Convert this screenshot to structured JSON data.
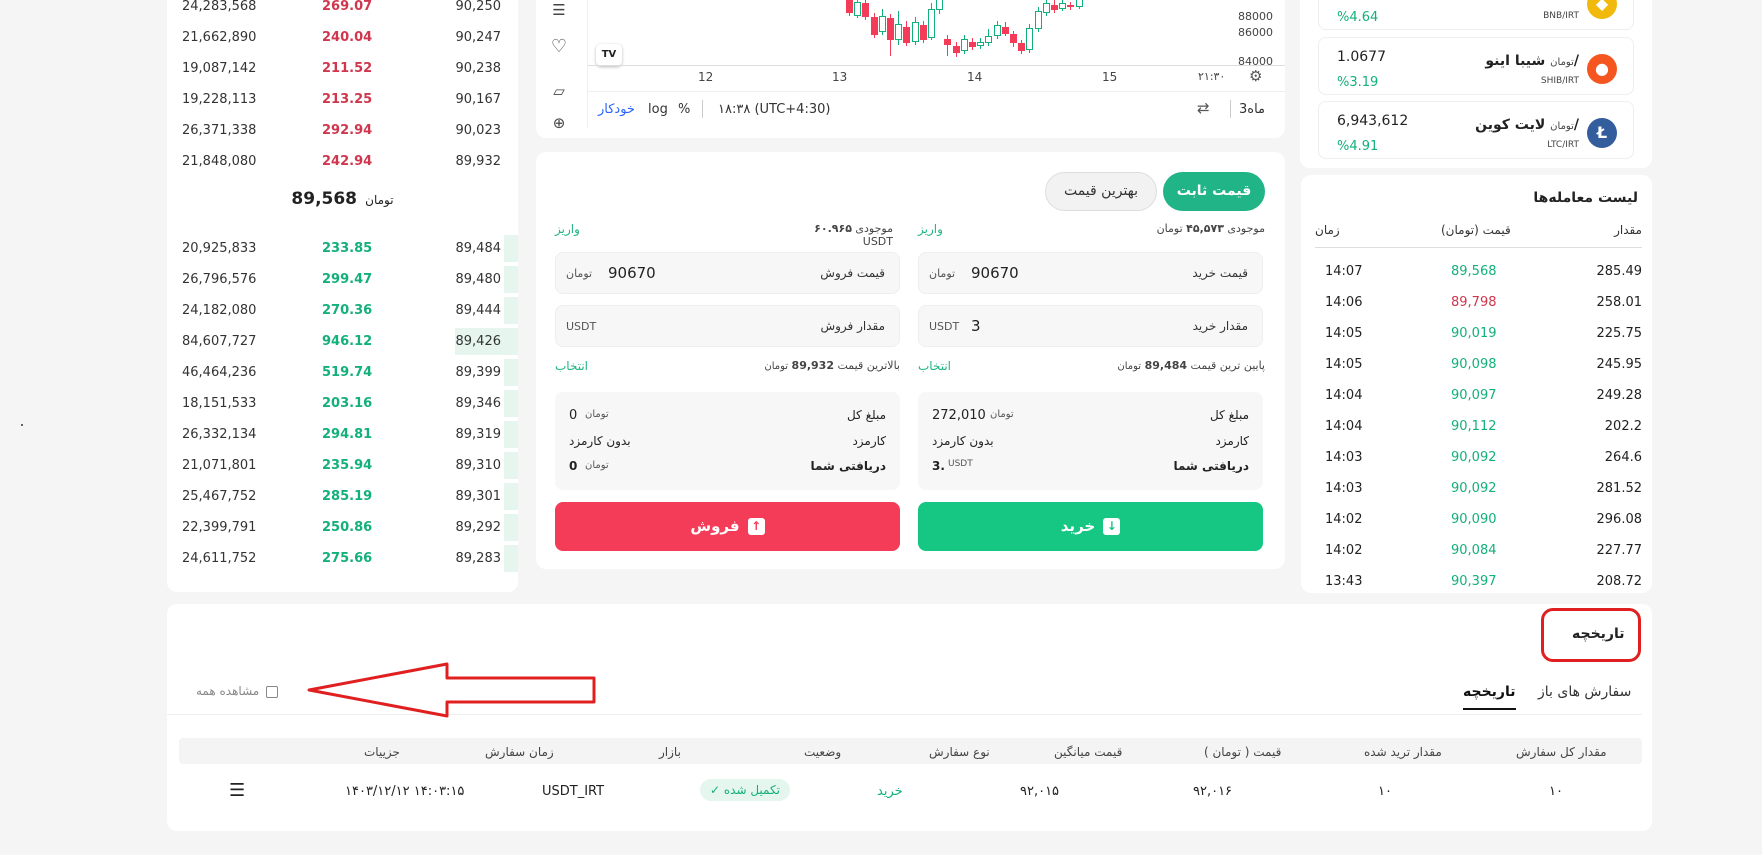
{
  "orderbook": {
    "asks": [
      {
        "total": "24,283,568",
        "amount": "269.07",
        "price": "90,250"
      },
      {
        "total": "21,662,890",
        "amount": "240.04",
        "price": "90,247"
      },
      {
        "total": "19,087,142",
        "amount": "211.52",
        "price": "90,238"
      },
      {
        "total": "19,228,113",
        "amount": "213.25",
        "price": "90,167"
      },
      {
        "total": "26,371,338",
        "amount": "292.94",
        "price": "90,023"
      },
      {
        "total": "21,848,080",
        "amount": "242.94",
        "price": "89,932"
      }
    ],
    "last_price": "89,568",
    "last_unit": "تومان",
    "bids": [
      {
        "total": "20,925,833",
        "amount": "233.85",
        "price": "89,484",
        "depth": 0.04
      },
      {
        "total": "26,796,576",
        "amount": "299.47",
        "price": "89,480",
        "depth": 0.04
      },
      {
        "total": "24,182,080",
        "amount": "270.36",
        "price": "89,444",
        "depth": 0.04
      },
      {
        "total": "84,607,727",
        "amount": "946.12",
        "price": "89,426",
        "depth": 0.18
      },
      {
        "total": "46,464,236",
        "amount": "519.74",
        "price": "89,399",
        "depth": 0.04
      },
      {
        "total": "18,151,533",
        "amount": "203.16",
        "price": "89,346",
        "depth": 0.04
      },
      {
        "total": "26,332,134",
        "amount": "294.81",
        "price": "89,319",
        "depth": 0.04
      },
      {
        "total": "21,071,801",
        "amount": "235.94",
        "price": "89,310",
        "depth": 0.04
      },
      {
        "total": "25,467,752",
        "amount": "285.19",
        "price": "89,301",
        "depth": 0.04
      },
      {
        "total": "22,399,791",
        "amount": "250.86",
        "price": "89,292",
        "depth": 0.04
      },
      {
        "total": "24,611,752",
        "amount": "275.66",
        "price": "89,283",
        "depth": 0.04
      }
    ]
  },
  "chart": {
    "price_ticks": [
      "88000",
      "86000",
      "84000"
    ],
    "time_ticks": [
      "12",
      "13",
      "14",
      "15",
      "۲۱:۳۰"
    ],
    "toolbar": {
      "auto": "خودکار",
      "log": "log",
      "percent": "%",
      "time": "۱۸:۳۸ (UTC+4:30)",
      "range": "3ماه"
    },
    "logo": "TV",
    "candles": [
      {
        "o": 88600,
        "c": 87600,
        "h": 88900,
        "l": 87400
      },
      {
        "o": 87400,
        "c": 88400,
        "h": 88800,
        "l": 87200
      },
      {
        "o": 88300,
        "c": 87300,
        "h": 88700,
        "l": 87100
      },
      {
        "o": 87300,
        "c": 86000,
        "h": 87600,
        "l": 85800
      },
      {
        "o": 86200,
        "c": 87400,
        "h": 87900,
        "l": 86000
      },
      {
        "o": 87200,
        "c": 85600,
        "h": 87500,
        "l": 84500
      },
      {
        "o": 85600,
        "c": 86800,
        "h": 87700,
        "l": 85300
      },
      {
        "o": 86600,
        "c": 85400,
        "h": 87000,
        "l": 85200
      },
      {
        "o": 85500,
        "c": 86900,
        "h": 87300,
        "l": 85300
      },
      {
        "o": 86700,
        "c": 85600,
        "h": 87000,
        "l": 85400
      },
      {
        "o": 85800,
        "c": 87900,
        "h": 88300,
        "l": 85600
      },
      {
        "o": 87800,
        "c": 88600,
        "h": 88900,
        "l": 87500
      },
      {
        "o": 85700,
        "c": 85300,
        "h": 86000,
        "l": 84500
      },
      {
        "o": 85200,
        "c": 84700,
        "h": 85500,
        "l": 84400
      },
      {
        "o": 84800,
        "c": 85700,
        "h": 86000,
        "l": 84600
      },
      {
        "o": 85500,
        "c": 85100,
        "h": 85800,
        "l": 84900
      },
      {
        "o": 85200,
        "c": 85500,
        "h": 85800,
        "l": 85000
      },
      {
        "o": 85400,
        "c": 85900,
        "h": 86400,
        "l": 85200
      },
      {
        "o": 85900,
        "c": 86700,
        "h": 87000,
        "l": 85700
      },
      {
        "o": 86600,
        "c": 86100,
        "h": 86900,
        "l": 85900
      },
      {
        "o": 86100,
        "c": 85400,
        "h": 86300,
        "l": 85100
      },
      {
        "o": 85400,
        "c": 84800,
        "h": 85600,
        "l": 84600
      },
      {
        "o": 84900,
        "c": 86500,
        "h": 86800,
        "l": 84700
      },
      {
        "o": 86400,
        "c": 87700,
        "h": 88000,
        "l": 86200
      },
      {
        "o": 87600,
        "c": 88300,
        "h": 88700,
        "l": 87400
      },
      {
        "o": 88200,
        "c": 87800,
        "h": 88500,
        "l": 87600
      },
      {
        "o": 87900,
        "c": 88300,
        "h": 88500,
        "l": 87700
      },
      {
        "o": 88200,
        "c": 88000,
        "h": 88400,
        "l": 87800
      },
      {
        "o": 88000,
        "c": 89000,
        "h": 89300,
        "l": 87900
      }
    ]
  },
  "trade": {
    "tab_fixed": "قیمت ثابت",
    "tab_best": "بهترین قیمت",
    "buy": {
      "balance_label": "موجودی",
      "balance": "۴۵,۵۷۳",
      "balance_unit": "تومان",
      "deposit": "واریز",
      "price_label": "قیمت خرید",
      "price": "90670",
      "price_unit": "تومان",
      "amount_label": "مقدار خرید",
      "amount": "3",
      "amount_unit": "USDT",
      "limit_label": "پایین ترین قیمت",
      "limit_value": "89,484",
      "limit_unit": "تومان",
      "select": "انتخاب",
      "total_label": "مبلغ کل",
      "total_value": "272,010",
      "total_unit": "تومان",
      "fee_label": "کارمزد",
      "fee_value": "بدون کارمزد",
      "receive_label": "دریافتی شما",
      "receive_value": "3.",
      "receive_unit": "USDT",
      "button": "خرید"
    },
    "sell": {
      "balance_label": "موجودی",
      "balance": "۶۰.۹۶۵",
      "balance_unit": "USDT",
      "deposit": "واریز",
      "price_label": "قیمت فروش",
      "price": "90670",
      "price_unit": "تومان",
      "amount_label": "مقدار فروش",
      "amount": "",
      "amount_unit": "USDT",
      "limit_label": "بالاترین قیمت",
      "limit_value": "89,932",
      "limit_unit": "تومان",
      "select": "انتخاب",
      "total_label": "مبلغ کل",
      "total_value": "0",
      "total_unit": "تومان",
      "fee_label": "کارمزد",
      "fee_value": "بدون کارمزد",
      "receive_label": "دریافتی شما",
      "receive_value": "0",
      "receive_unit": "تومان",
      "button": "فروش"
    }
  },
  "coins": [
    {
      "price": "",
      "change": "%4.64",
      "name": "",
      "unit": "",
      "symbol": "BNB/IRT",
      "logo_color": "#f0b90b",
      "logo": "◆"
    },
    {
      "price": "1.0677",
      "change": "%3.19",
      "name": "شیبا اینو/",
      "unit": "تومان",
      "symbol": "SHIB/IRT",
      "logo_color": "#f5561f",
      "logo": "●"
    },
    {
      "price": "6,943,612",
      "change": "%4.91",
      "name": "لایت کوین/",
      "unit": "تومان",
      "symbol": "LTC/IRT",
      "logo_color": "#345d9d",
      "logo": "Ł"
    }
  ],
  "trades": {
    "title": "لیست معامله‌ها",
    "col_amount": "مقدار",
    "col_price": "قیمت (تومان)",
    "col_time": "زمان",
    "rows": [
      {
        "q": "285.49",
        "p": "89,568",
        "t": "14:07",
        "side": "buy"
      },
      {
        "q": "258.01",
        "p": "89,798",
        "t": "14:06",
        "side": "sell"
      },
      {
        "q": "225.75",
        "p": "90,019",
        "t": "14:05",
        "side": "buy"
      },
      {
        "q": "245.95",
        "p": "90,098",
        "t": "14:05",
        "side": "buy"
      },
      {
        "q": "249.28",
        "p": "90,097",
        "t": "14:04",
        "side": "buy"
      },
      {
        "q": "202.2",
        "p": "90,112",
        "t": "14:04",
        "side": "buy"
      },
      {
        "q": "264.6",
        "p": "90,092",
        "t": "14:03",
        "side": "buy"
      },
      {
        "q": "281.52",
        "p": "90,092",
        "t": "14:03",
        "side": "buy"
      },
      {
        "q": "296.08",
        "p": "90,090",
        "t": "14:02",
        "side": "buy"
      },
      {
        "q": "227.77",
        "p": "90,084",
        "t": "14:02",
        "side": "buy"
      },
      {
        "q": "208.72",
        "p": "90,397",
        "t": "13:43",
        "side": "buy"
      }
    ]
  },
  "history": {
    "title": "تاریخچه",
    "tab_open": "سفارش های باز",
    "tab_history": "تاریخچه",
    "view_all": "مشاهده همه",
    "columns": [
      "مقدار کل سفارش",
      "مقدار ترید شده",
      "قیمت ( تومان )",
      "قیمت میانگین",
      "نوع سفارش",
      "وضعیت",
      "بازار",
      "زمان سفارش",
      "جزییات"
    ],
    "row": {
      "total": "۱۰",
      "traded": "۱۰",
      "price": "۹۲,۰۱۶",
      "avg": "۹۲,۰۱۵",
      "type": "خرید",
      "status": "تکمیل شده",
      "market": "USDT_IRT",
      "time": "۱۴۰۳/۱۲/۱۲ ۱۴:۰۳:۱۵"
    }
  },
  "colors": {
    "green": "#13b07a",
    "red": "#f43c58",
    "accent_teal": "#20b486",
    "annotation_red": "#e02020"
  }
}
